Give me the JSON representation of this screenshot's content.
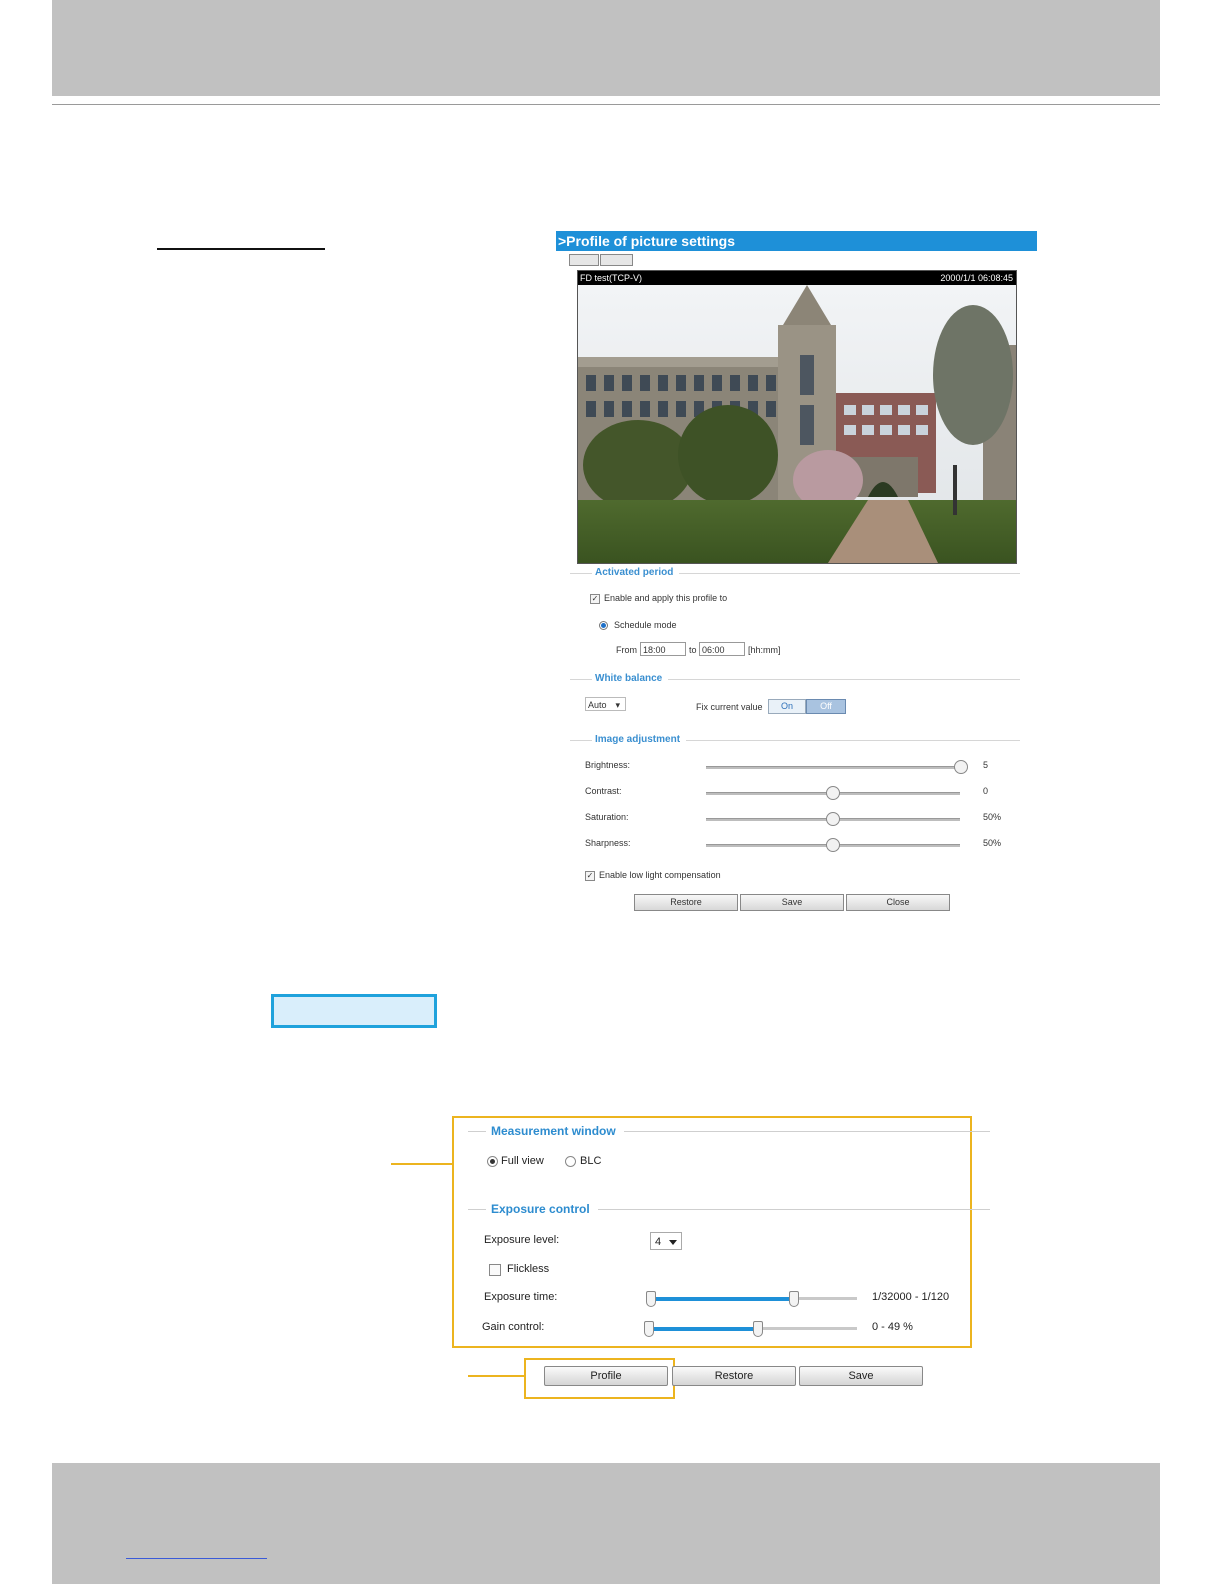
{
  "profile_panel": {
    "title": ">Profile of picture settings",
    "view_buttons": [
      "",
      ""
    ],
    "video": {
      "stream_label": "FD test(TCP-V)",
      "timestamp": "2000/1/1 06:08:45"
    },
    "activated_period": {
      "heading": "Activated period",
      "enable_label": "Enable and apply this profile to",
      "schedule_label": "Schedule mode",
      "from_label": "From",
      "from_value": "18:00",
      "to_label": "to",
      "to_value": "06:00",
      "format_hint": "[hh:mm]"
    },
    "white_balance": {
      "heading": "White balance",
      "mode": "Auto",
      "fix_label": "Fix current value",
      "on_label": "On",
      "off_label": "Off"
    },
    "image_adjustment": {
      "heading": "Image adjustment",
      "rows": [
        {
          "label": "Brightness:",
          "value": "5",
          "level": 1.0
        },
        {
          "label": "Contrast:",
          "value": "0",
          "level": 0.5
        },
        {
          "label": "Saturation:",
          "value": "50%",
          "level": 0.5
        },
        {
          "label": "Sharpness:",
          "value": "50%",
          "level": 0.5
        }
      ],
      "low_light_label": "Enable low light compensation"
    },
    "buttons": {
      "restore": "Restore",
      "save": "Save",
      "close": "Close"
    }
  },
  "exposure_panel": {
    "measurement_window": {
      "heading": "Measurement window",
      "full_view_label": "Full view",
      "blc_label": "BLC",
      "selected": "Full view"
    },
    "exposure_control": {
      "heading": "Exposure control",
      "level_label": "Exposure level:",
      "level_value": "4",
      "flickless_label": "Flickless",
      "time_label": "Exposure time:",
      "time_value": "1/32000 - 1/120",
      "time_range_fraction": [
        0.0,
        0.7
      ],
      "gain_label": "Gain control:",
      "gain_value": "0 - 49 %",
      "gain_range_fraction": [
        0.0,
        0.52
      ]
    },
    "buttons": {
      "profile": "Profile",
      "restore": "Restore",
      "save": "Save"
    }
  },
  "colors": {
    "accent_blue": "#1e90d8",
    "highlight_orange": "#ecb41f",
    "band_gray": "#c1c1c1"
  }
}
